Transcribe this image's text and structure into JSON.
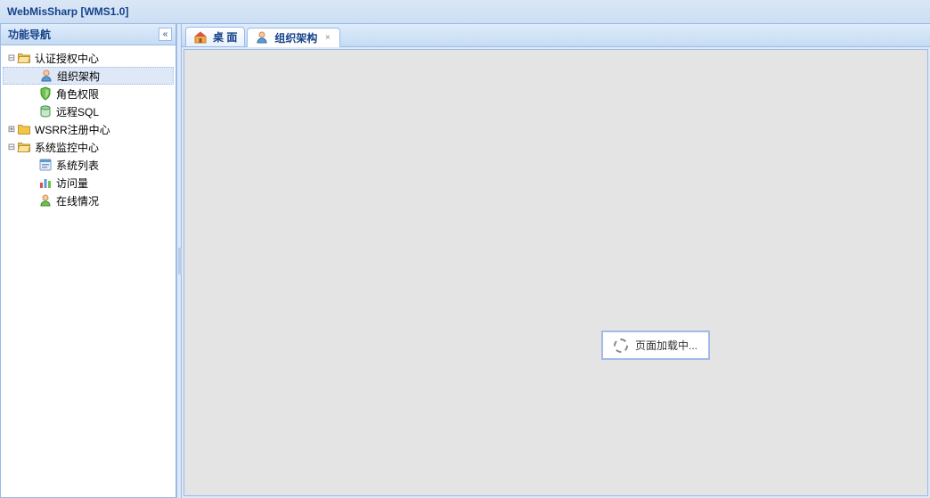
{
  "app_title": "WebMisSharp [WMS1.0]",
  "sidebar": {
    "title": "功能导航",
    "nodes": [
      {
        "id": "auth-center",
        "label": "认证授权中心",
        "expanded": true,
        "icon": "folder-open",
        "level": 0
      },
      {
        "id": "org-structure",
        "label": "组织架构",
        "icon": "user",
        "level": 1,
        "selected": true
      },
      {
        "id": "role-perm",
        "label": "角色权限",
        "icon": "shield",
        "level": 1
      },
      {
        "id": "remote-sql",
        "label": "远程SQL",
        "icon": "db",
        "level": 1
      },
      {
        "id": "wsrr-center",
        "label": "WSRR注册中心",
        "expanded": false,
        "icon": "folder",
        "level": 0
      },
      {
        "id": "monitor-center",
        "label": "系统监控中心",
        "expanded": true,
        "icon": "folder-open",
        "level": 0
      },
      {
        "id": "system-list",
        "label": "系统列表",
        "icon": "app",
        "level": 1
      },
      {
        "id": "visits",
        "label": "访问量",
        "icon": "chart",
        "level": 1
      },
      {
        "id": "online",
        "label": "在线情况",
        "icon": "user-green",
        "level": 1
      }
    ]
  },
  "tabs": {
    "items": [
      {
        "id": "desktop",
        "label": "桌 面",
        "icon": "home",
        "closable": false,
        "active": false
      },
      {
        "id": "org-structure-tab",
        "label": "组织架构",
        "icon": "user",
        "closable": true,
        "active": true
      }
    ]
  },
  "loading_text": "页面加载中..."
}
